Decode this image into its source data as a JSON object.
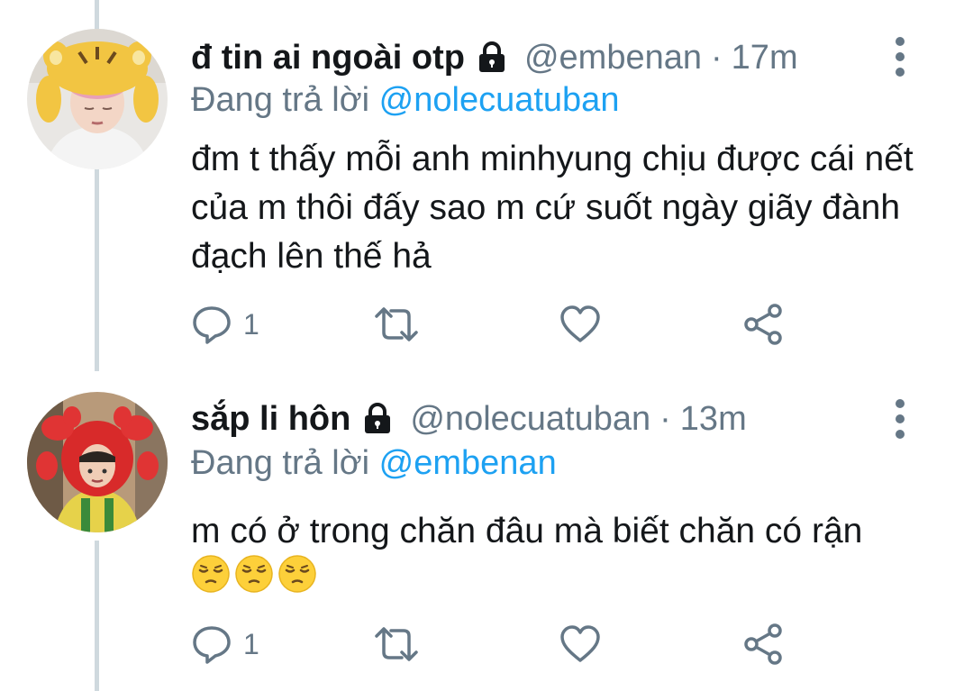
{
  "colors": {
    "accent": "#1da1f2",
    "secondary_text": "#657786",
    "primary_text": "#14171a",
    "thread_line": "#cfd9de"
  },
  "tweets": [
    {
      "display_name": "đ tin ai ngoài otp",
      "locked": true,
      "lock_icon": "lock-icon",
      "handle": "@embenan",
      "separator": "·",
      "time": "17m",
      "reply_prefix": "Đang trả lời",
      "reply_to": "@nolecuatuban",
      "text": "đm t thấy mỗi anh minhyung chịu được cái nết của m thôi đấy sao m cứ suốt ngày giãy đành đạch lên thế hả",
      "emojis": [],
      "reply_count": "1",
      "icons": [
        "reply-icon",
        "retweet-icon",
        "like-icon",
        "share-icon",
        "more-icon"
      ]
    },
    {
      "display_name": "sắp li hôn",
      "locked": true,
      "lock_icon": "lock-icon",
      "handle": "@nolecuatuban",
      "separator": "·",
      "time": "13m",
      "reply_prefix": "Đang trả lời",
      "reply_to": "@embenan",
      "text": "m có ở trong chăn đâu mà biết chăn có rận",
      "emojis": [
        "pensive-face",
        "pensive-face",
        "pensive-face"
      ],
      "reply_count": "1",
      "icons": [
        "reply-icon",
        "retweet-icon",
        "like-icon",
        "share-icon",
        "more-icon"
      ]
    }
  ]
}
